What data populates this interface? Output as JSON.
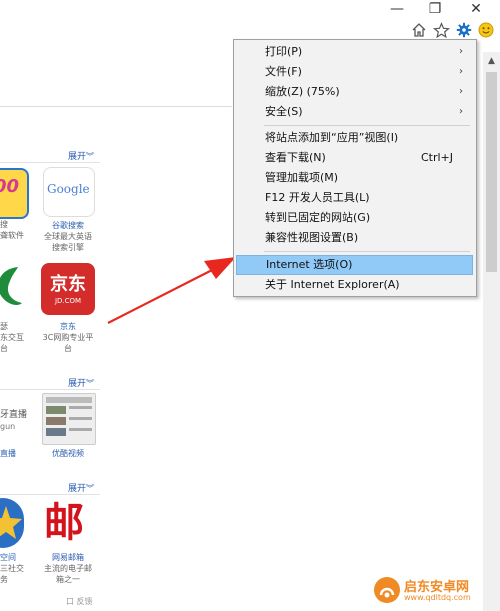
{
  "window": {
    "minimize_glyph": "—",
    "restore_glyph": "❐",
    "close_glyph": "✕"
  },
  "toolbar": {
    "home_icon": "home-icon",
    "favorites_icon": "star-icon",
    "tools_icon": "gear-icon",
    "feedback_icon": "smiley-icon"
  },
  "menu": {
    "items": [
      {
        "label": "打印(P)",
        "submenu": true
      },
      {
        "label": "文件(F)",
        "submenu": true
      },
      {
        "label": "缩放(Z) (75%)",
        "submenu": true
      },
      {
        "label": "安全(S)",
        "submenu": true
      },
      {
        "label": "将站点添加到“应用”视图(I)"
      },
      {
        "label": "查看下载(N)",
        "shortcut": "Ctrl+J"
      },
      {
        "label": "管理加载项(M)"
      },
      {
        "label": "F12 开发人员工具(L)"
      },
      {
        "label": "转到已固定的网站(G)"
      },
      {
        "label": "兼容性视图设置(B)"
      },
      {
        "label": "Internet 选项(O)",
        "highlighted": true
      },
      {
        "label": "关于 Internet Explorer(A)"
      }
    ],
    "arrow_glyph": "›"
  },
  "page": {
    "expand_label": "展开",
    "expand_chevron": "︾",
    "apps": {
      "google": {
        "logo": "Google",
        "name": "谷歌搜索",
        "desc1": "全球最大英语",
        "desc2": "搜索引擎"
      },
      "jd": {
        "logo1": "京东",
        "logo2": "JD.COM",
        "name": "京东",
        "desc1": "3C网购专业平",
        "desc2": "台"
      },
      "youku": {
        "name": "优酷视频"
      },
      "mail163": {
        "logo": "邮",
        "name": "网易邮箱",
        "desc1": "主流的电子邮",
        "desc2": "箱之一"
      }
    },
    "left_partial": {
      "r1_a": "搜",
      "r1_b": "聋软件",
      "r2_a": "瑟",
      "r2_b": "东交互",
      "r2_c": "台",
      "r3_a": "牙直播",
      "r3_b": "gun",
      "r3_c": "直播",
      "r4_a": "空间",
      "r4_b": "三社交",
      "r4_c": "务"
    },
    "bottom_hint": "口 反馈",
    "watermark": {
      "title": "启东安卓网",
      "url": "www.qdltdq.com"
    }
  }
}
